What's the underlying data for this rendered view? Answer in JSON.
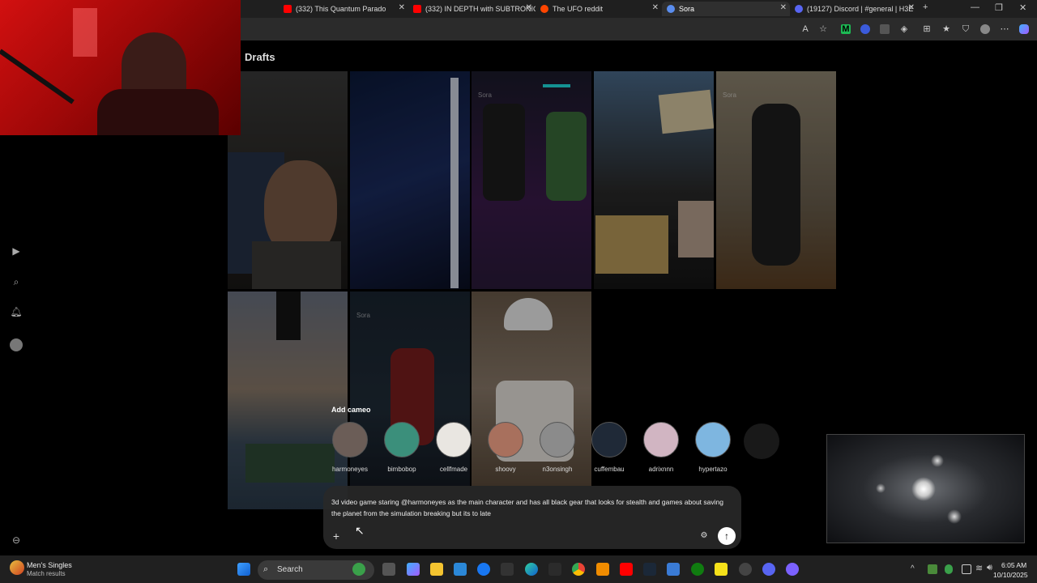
{
  "browser": {
    "tabs": [
      {
        "label": "(332) This Quantum Parado",
        "icon": "youtube-icon",
        "color": "#ff0000",
        "active": false
      },
      {
        "label": "(332) IN DEPTH with SUBTRONIC",
        "icon": "youtube-icon",
        "color": "#ff0000",
        "active": false
      },
      {
        "label": "The UFO reddit",
        "icon": "reddit-icon",
        "color": "#ff4500",
        "active": false
      },
      {
        "label": "Sora",
        "icon": "sora-icon",
        "color": "#5a8dee",
        "active": true
      },
      {
        "label": "(19127) Discord | #general | H3E",
        "icon": "discord-icon",
        "color": "#5865f2",
        "active": false
      }
    ],
    "new_tab": "+",
    "window_controls": [
      "—",
      "❐",
      "✕"
    ]
  },
  "page": {
    "title": "Drafts",
    "watermark": "Sora",
    "nav_icons": [
      "play-icon",
      "search-icon",
      "bell-icon",
      "profile-icon"
    ],
    "cameo_label": "Add cameo",
    "cameos": [
      {
        "name": "harmoneyes",
        "color": "#6b5d57"
      },
      {
        "name": "bimbobop",
        "color": "#3b8f7b"
      },
      {
        "name": "cellfmade",
        "color": "#e9e6e1"
      },
      {
        "name": "shoovy",
        "color": "#a8705d"
      },
      {
        "name": "n3onsingh",
        "color": "#8b8b8b"
      },
      {
        "name": "cuffembau",
        "color": "#1f2937"
      },
      {
        "name": "adrixnnn",
        "color": "#d1b5c2"
      },
      {
        "name": "hypertazo",
        "color": "#7eb6e0"
      }
    ],
    "prompt_text": "3d video game staring @harmoneyes as the main character and has all black gear that looks for stealth and games about saving the planet from the simulation breaking but its to late",
    "add_label": "+",
    "send_label": "↑"
  },
  "taskbar": {
    "widget_title": "Men's Singles",
    "widget_subtitle": "Match results",
    "search_label": "Search",
    "time": "6:05 AM",
    "date": "10/10/2025"
  }
}
